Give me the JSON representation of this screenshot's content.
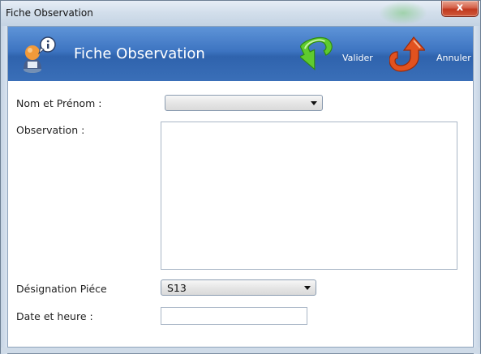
{
  "window": {
    "title": "Fiche Observation",
    "close_glyph": "x"
  },
  "header": {
    "title": "Fiche Observation",
    "icon": "user-info-icon",
    "valider_label": "Valider",
    "valider_icon": "green-check-arrow-icon",
    "annuler_label": "Annuler",
    "annuler_icon": "red-undo-arrow-icon"
  },
  "form": {
    "nom_label": "Nom et Prénom :",
    "nom_value": "",
    "observation_label": "Observation :",
    "observation_value": "",
    "piece_label": "Désignation Piéce",
    "piece_value": "S13",
    "date_label": "Date et heure :",
    "date_value": ""
  },
  "colors": {
    "header_blue": "#3d74c1",
    "header_text": "#ffffff",
    "close_red": "#c0391f"
  }
}
